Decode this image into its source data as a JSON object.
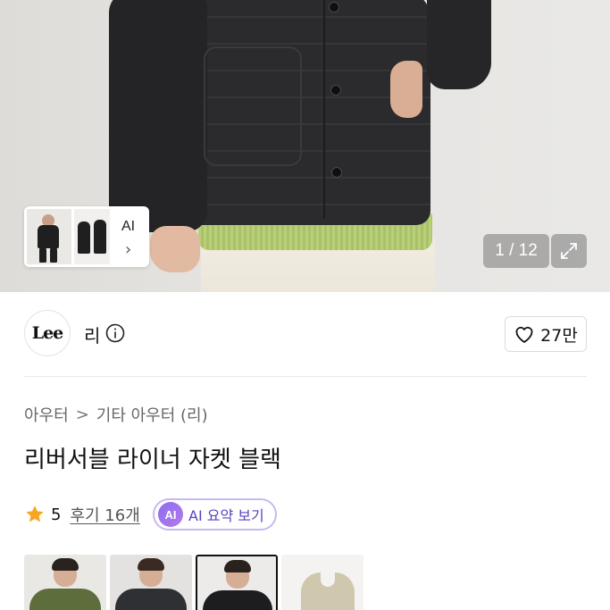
{
  "hero": {
    "ai_thumb_label": "AI",
    "ai_thumb_chevron": "›",
    "counter": "1 / 12",
    "expand_icon": "expand-icon"
  },
  "brand": {
    "logo_text": "Lee",
    "name": "리",
    "info_icon": "info-icon"
  },
  "like": {
    "icon": "heart-outline-icon",
    "count": "27만"
  },
  "breadcrumb": {
    "items": [
      "아우터",
      "기타 아우터 (리)"
    ],
    "separator": ">"
  },
  "product": {
    "title": "리버서블 라이너 자켓 블랙"
  },
  "rating": {
    "star_icon": "star-icon",
    "score": "5",
    "reviews": "후기 16개"
  },
  "ai_summary": {
    "badge": "AI",
    "label": "AI 요약 보기"
  },
  "colors": {
    "accent_star": "#f5a623",
    "accent_ai": "#7b5ce6",
    "swatches": [
      {
        "name": "khaki",
        "color": "#5d6e3c",
        "selected": false
      },
      {
        "name": "charcoal",
        "color": "#2f3033",
        "selected": false
      },
      {
        "name": "black",
        "color": "#1d1d1f",
        "selected": true
      },
      {
        "name": "beige",
        "color": "#cfc7ae",
        "selected": false
      }
    ]
  }
}
